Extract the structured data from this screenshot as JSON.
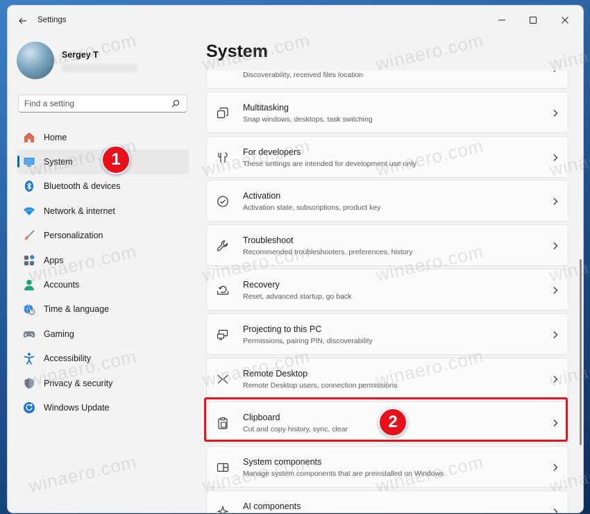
{
  "window": {
    "title": "Settings",
    "controls": {
      "minimize_icon": "minimize-icon",
      "maximize_icon": "maximize-icon",
      "close_icon": "close-icon"
    },
    "back_icon": "back-arrow-icon"
  },
  "user": {
    "name": "Sergey T"
  },
  "search": {
    "placeholder": "Find a setting",
    "icon": "search-icon"
  },
  "sidebar": {
    "items": [
      {
        "label": "Home",
        "icon": "home-icon",
        "active": false
      },
      {
        "label": "System",
        "icon": "system-display-icon",
        "active": true
      },
      {
        "label": "Bluetooth & devices",
        "icon": "bluetooth-icon",
        "active": false
      },
      {
        "label": "Network & internet",
        "icon": "wifi-icon",
        "active": false
      },
      {
        "label": "Personalization",
        "icon": "brush-icon",
        "active": false
      },
      {
        "label": "Apps",
        "icon": "apps-icon",
        "active": false
      },
      {
        "label": "Accounts",
        "icon": "person-icon",
        "active": false
      },
      {
        "label": "Time & language",
        "icon": "globe-clock-icon",
        "active": false
      },
      {
        "label": "Gaming",
        "icon": "gamepad-icon",
        "active": false
      },
      {
        "label": "Accessibility",
        "icon": "accessibility-icon",
        "active": false
      },
      {
        "label": "Privacy & security",
        "icon": "shield-icon",
        "active": false
      },
      {
        "label": "Windows Update",
        "icon": "update-icon",
        "active": false
      }
    ]
  },
  "main": {
    "title": "System",
    "settings": [
      {
        "title": "",
        "subtitle": "Discoverability, received files location",
        "icon": "share-icon"
      },
      {
        "title": "Multitasking",
        "subtitle": "Snap windows, desktops, task switching",
        "icon": "multitasking-icon"
      },
      {
        "title": "For developers",
        "subtitle": "These settings are intended for development use only",
        "icon": "developer-tools-icon"
      },
      {
        "title": "Activation",
        "subtitle": "Activation state, subscriptions, product key",
        "icon": "check-circle-icon"
      },
      {
        "title": "Troubleshoot",
        "subtitle": "Recommended troubleshooters, preferences, history",
        "icon": "wrench-icon"
      },
      {
        "title": "Recovery",
        "subtitle": "Reset, advanced startup, go back",
        "icon": "recovery-icon"
      },
      {
        "title": "Projecting to this PC",
        "subtitle": "Permissions, pairing PIN, discoverability",
        "icon": "projector-icon"
      },
      {
        "title": "Remote Desktop",
        "subtitle": "Remote Desktop users, connection permissions",
        "icon": "remote-desktop-icon"
      },
      {
        "title": "Clipboard",
        "subtitle": "Cut and copy history, sync, clear",
        "icon": "clipboard-icon"
      },
      {
        "title": "System components",
        "subtitle": "Manage system components that are preinstalled on Windows",
        "icon": "components-icon"
      },
      {
        "title": "AI components",
        "subtitle": "",
        "icon": "ai-icon"
      }
    ]
  },
  "annotations": {
    "badge1": "1",
    "badge2": "2"
  },
  "watermark": "winaero.com",
  "colors": {
    "accent": "#0067c0",
    "badge": "#e8101b",
    "highlight": "#e3141b"
  }
}
